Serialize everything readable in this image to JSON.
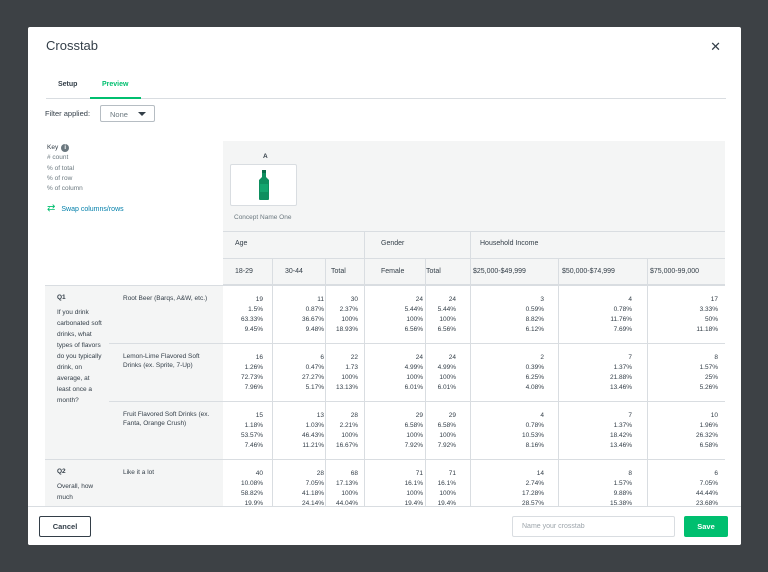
{
  "modal": {
    "title": "Crosstab",
    "close_icon": "close-icon"
  },
  "tabs": [
    {
      "label": "Setup",
      "active": false
    },
    {
      "label": "Preview",
      "active": true
    }
  ],
  "filter": {
    "label": "Filter applied:",
    "value": "None"
  },
  "key": {
    "title": "Key",
    "items": [
      "# count",
      "% of total",
      "% of row",
      "% of column"
    ]
  },
  "swap": {
    "label": "Swap columns/rows"
  },
  "concept": {
    "letter": "A",
    "name": "Concept Name One",
    "image_icon": "green-bottle-icon"
  },
  "column_groups": [
    {
      "label": "Age",
      "subs": [
        "18-29",
        "30-44",
        "Total"
      ]
    },
    {
      "label": "Gender",
      "subs": [
        "Female",
        "Total"
      ]
    },
    {
      "label": "Household Income",
      "subs": [
        "$25,000-$49,999",
        "$50,000-$74,999",
        "$75,000-99,000"
      ]
    }
  ],
  "questions": [
    {
      "id": "Q1",
      "text": "If you drink carbonated soft drinks, what types of flavors do you typically drink, on average, at least once a month?",
      "rows": [
        {
          "label": "Root Beer (Barqs, A&W, etc.)",
          "cells": [
            [
              "19",
              "1.5%",
              "63.33%",
              "9.45%"
            ],
            [
              "11",
              "0.87%",
              "36.67%",
              "9.48%"
            ],
            [
              "30",
              "2.37%",
              "100%",
              "18.93%"
            ],
            [
              "24",
              "5.44%",
              "100%",
              "6.56%"
            ],
            [
              "24",
              "5.44%",
              "100%",
              "6.56%"
            ],
            [
              "3",
              "0.59%",
              "8.82%",
              "6.12%"
            ],
            [
              "4",
              "0.78%",
              "11.76%",
              "7.69%"
            ],
            [
              "17",
              "3.33%",
              "50%",
              "11.18%"
            ]
          ]
        },
        {
          "label": "Lemon-Lime Flavored Soft Drinks (ex. Sprite, 7-Up)",
          "cells": [
            [
              "16",
              "1.26%",
              "72.73%",
              "7.96%"
            ],
            [
              "6",
              "0.47%",
              "27.27%",
              "5.17%"
            ],
            [
              "22",
              "1.73",
              "100%",
              "13.13%"
            ],
            [
              "24",
              "4.99%",
              "100%",
              "6.01%"
            ],
            [
              "24",
              "4.99%",
              "100%",
              "6.01%"
            ],
            [
              "2",
              "0.39%",
              "6.25%",
              "4.08%"
            ],
            [
              "7",
              "1.37%",
              "21.88%",
              "13.46%"
            ],
            [
              "8",
              "1.57%",
              "25%",
              "5.26%"
            ]
          ]
        },
        {
          "label": "Fruit Flavored Soft Drinks (ex. Fanta, Orange Crush)",
          "cells": [
            [
              "15",
              "1.18%",
              "53.57%",
              "7.46%"
            ],
            [
              "13",
              "1.03%",
              "46.43%",
              "11.21%"
            ],
            [
              "28",
              "2.21%",
              "100%",
              "16.67%"
            ],
            [
              "29",
              "6.58%",
              "100%",
              "7.92%"
            ],
            [
              "29",
              "6.58%",
              "100%",
              "7.92%"
            ],
            [
              "4",
              "0.78%",
              "10.53%",
              "8.16%"
            ],
            [
              "7",
              "1.37%",
              "18.42%",
              "13.46%"
            ],
            [
              "10",
              "1.96%",
              "26.32%",
              "6.58%"
            ]
          ]
        }
      ]
    },
    {
      "id": "Q2",
      "text": "Overall, how much",
      "rows": [
        {
          "label": "Like it a lot",
          "cells": [
            [
              "40",
              "10.08%",
              "58.82%",
              "19.9%"
            ],
            [
              "28",
              "7.05%",
              "41.18%",
              "24.14%"
            ],
            [
              "68",
              "17.13%",
              "100%",
              "44.04%"
            ],
            [
              "71",
              "16.1%",
              "100%",
              "19.4%"
            ],
            [
              "71",
              "16.1%",
              "100%",
              "19.4%"
            ],
            [
              "14",
              "2.74%",
              "17.28%",
              "28.57%"
            ],
            [
              "8",
              "1.57%",
              "9.88%",
              "15.38%"
            ],
            [
              "6",
              "7.05%",
              "44.44%",
              "23.68%"
            ]
          ]
        }
      ]
    }
  ],
  "footer": {
    "cancel_label": "Cancel",
    "name_placeholder": "Name your crosstab",
    "save_label": "Save"
  },
  "colors": {
    "accent": "#00bf6f",
    "link": "#007faa",
    "text": "#333e48",
    "panel": "#f4f5f5"
  }
}
